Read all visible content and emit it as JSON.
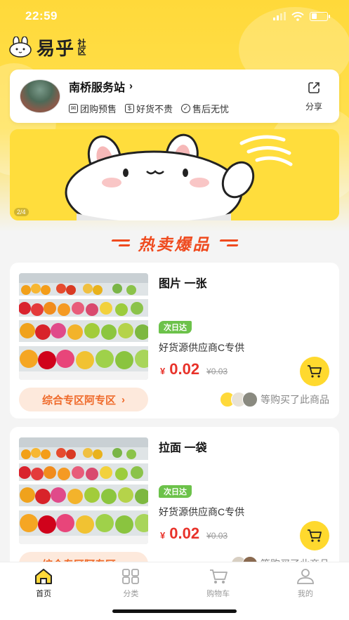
{
  "status_bar": {
    "time": "22:59"
  },
  "brand": {
    "name": "易乎",
    "sub": "社区",
    "logo_icon": "rabbit-logo-icon"
  },
  "station": {
    "name": "南桥服务站",
    "tags": [
      {
        "icon": "mail-icon",
        "label": "团购预售"
      },
      {
        "icon": "dollar-icon",
        "label": "好货不贵"
      },
      {
        "icon": "check-circle-icon",
        "label": "售后无忧"
      }
    ],
    "share_label": "分享"
  },
  "banner": {
    "index_text": "2/4"
  },
  "section": {
    "title": "热卖爆品"
  },
  "products": [
    {
      "name": "图片 一张",
      "badge": "次日达",
      "supplier": "好货源供应商C专供",
      "currency": "¥",
      "price": "0.02",
      "old_price": "¥0.03",
      "zone_label": "综合专区阿专区",
      "buyers_text": "等购买了此商品"
    },
    {
      "name": "拉面 一袋",
      "badge": "次日达",
      "supplier": "好货源供应商C专供",
      "currency": "¥",
      "price": "0.02",
      "old_price": "¥0.03",
      "zone_label": "综合专区阿专区",
      "buyers_text": "等购买了此商品"
    }
  ],
  "tabbar": {
    "items": [
      {
        "label": "首页",
        "icon": "home-icon",
        "active": true
      },
      {
        "label": "分类",
        "icon": "grid-icon",
        "active": false
      },
      {
        "label": "购物车",
        "icon": "cart-icon",
        "active": false
      },
      {
        "label": "我的",
        "icon": "user-icon",
        "active": false
      }
    ]
  },
  "colors": {
    "brand_yellow": "#ffd93a",
    "accent_red": "#e8322a",
    "title_orange": "#ef4a1e",
    "badge_green": "#6cc24a"
  }
}
